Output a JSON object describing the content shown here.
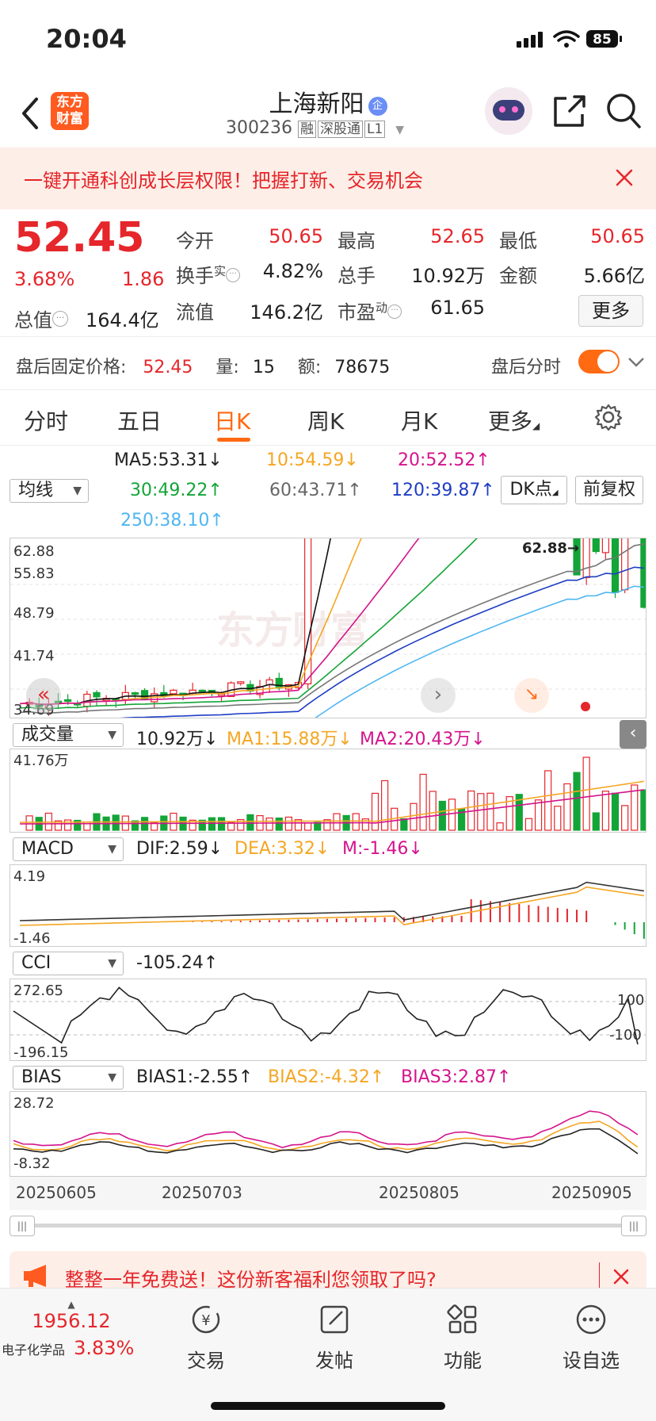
{
  "status_bar": {
    "time": "20:04",
    "battery": "85"
  },
  "header": {
    "logo_text": "东方\n财富",
    "title": "上海新阳",
    "title_badge": "企",
    "code": "300236",
    "tags": [
      "融",
      "深股通",
      "L1"
    ]
  },
  "promo": {
    "text": "一键开通科创成长层权限！把握打新、交易机会"
  },
  "quote": {
    "price": "52.45",
    "change_pct": "3.68%",
    "change": "1.86",
    "fields": [
      {
        "label": "今开",
        "value": "50.65",
        "color": "red"
      },
      {
        "label": "最高",
        "value": "52.65",
        "color": "red"
      },
      {
        "label": "最低",
        "value": "50.65",
        "color": "red"
      },
      {
        "label": "换手",
        "sup": "实",
        "value": "4.82%",
        "color": "dark"
      },
      {
        "label": "总手",
        "value": "10.92万",
        "color": "dark"
      },
      {
        "label": "金额",
        "value": "5.66亿",
        "color": "dark"
      },
      {
        "label": "总值",
        "value": "164.4亿",
        "color": "dark"
      },
      {
        "label": "流值",
        "value": "146.2亿",
        "color": "dark"
      },
      {
        "label": "市盈",
        "sup": "动",
        "value": "61.65",
        "color": "dark"
      }
    ],
    "more_label": "更多"
  },
  "after_hours": {
    "label": "盘后固定价格:",
    "price": "52.45",
    "vol_label": "量:",
    "vol": "15",
    "amt_label": "额:",
    "amt": "78675",
    "toggle_label": "盘后分时",
    "toggle_on": true
  },
  "tabs": [
    {
      "label": "分时",
      "active": false
    },
    {
      "label": "五日",
      "active": false
    },
    {
      "label": "日K",
      "active": true
    },
    {
      "label": "周K",
      "active": false
    },
    {
      "label": "月K",
      "active": false
    },
    {
      "label": "更多",
      "active": false
    }
  ],
  "ma_legend": {
    "selector": "均线",
    "ma5": "MA5:53.31↓",
    "ma10": "10:54.59↓",
    "ma20": "20:52.52↑",
    "ma30": "30:49.22↑",
    "ma60": "60:43.71↑",
    "ma120": "120:39.87↑",
    "ma250": "250:38.10↑",
    "dk_button": "DK点",
    "adjust_button": "前复权"
  },
  "kline_labels": {
    "max": "62.88",
    "l2": "55.83",
    "l3": "48.79",
    "l4": "41.74",
    "min": "34.69",
    "peak_label": "62.88→",
    "watermark": "东方财富"
  },
  "volume": {
    "selector": "成交量",
    "value": "10.92万↓",
    "ma1": "MA1:15.88万↓",
    "ma2": "MA2:20.43万↓",
    "max_label": "41.76万"
  },
  "macd": {
    "selector": "MACD",
    "dif": "DIF:2.59↓",
    "dea": "DEA:3.32↓",
    "m": "M:-1.46↓",
    "top": "4.19",
    "bottom": "-1.46"
  },
  "cci": {
    "selector": "CCI",
    "value": "-105.24↑",
    "top": "272.65",
    "bottom": "-196.15",
    "ref_hi": "100",
    "ref_lo": "-100"
  },
  "bias": {
    "selector": "BIAS",
    "b1": "BIAS1:-2.55↑",
    "b2": "BIAS2:-4.32↑",
    "b3": "BIAS3:2.87↑",
    "top": "28.72",
    "bottom": "-8.32"
  },
  "dates": [
    "20250605",
    "20250703",
    "20250805",
    "20250905"
  ],
  "ad_bar": {
    "text": "整整一年免费送！这份新客福利您领取了吗?"
  },
  "bottom_nav": {
    "index_value": "1956.12",
    "index_name": "电子化学品",
    "index_pct": "3.83%",
    "items": [
      {
        "label": "交易",
        "icon": "trade-icon"
      },
      {
        "label": "发帖",
        "icon": "post-icon"
      },
      {
        "label": "功能",
        "icon": "function-icon"
      },
      {
        "label": "设自选",
        "icon": "add-watchlist-icon"
      }
    ]
  },
  "colors": {
    "up": "#e5262b",
    "down": "#13a538",
    "accent": "#ff6a13",
    "ma10": "#f5a623",
    "ma20": "#d4148c",
    "ma120": "#1f3dc4",
    "ma250": "#4fb6f0"
  }
}
